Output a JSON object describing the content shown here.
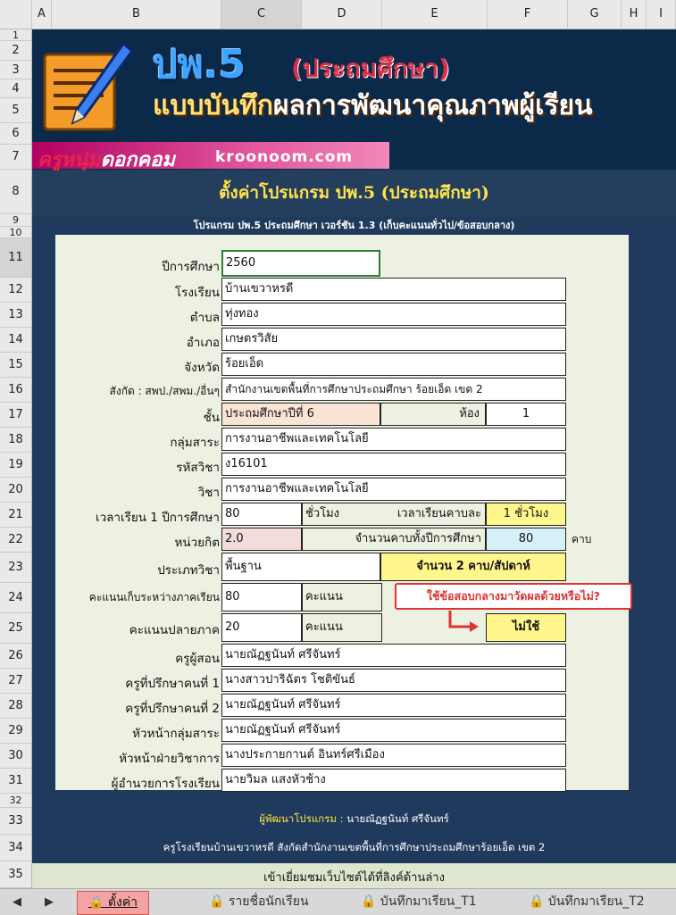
{
  "columns": [
    "A",
    "B",
    "C",
    "D",
    "E",
    "F",
    "G",
    "H",
    "I"
  ],
  "rows": [
    "1",
    "2",
    "3",
    "4",
    "5",
    "6",
    "7",
    "8",
    "9",
    "10",
    "11",
    "12",
    "13",
    "14",
    "15",
    "16",
    "17",
    "18",
    "19",
    "20",
    "21",
    "22",
    "23",
    "24",
    "25",
    "26",
    "27",
    "28",
    "29",
    "30",
    "31",
    "32",
    "33",
    "34",
    "35"
  ],
  "banner": {
    "title": "ปพ.5",
    "title_sub": "(ประถมศึกษา)",
    "line2_a": "แบบบันทึก",
    "line2_b": "ผลการพัฒนาคุณภาพผู้เรียน",
    "brand_a": "ครูหนุ่ม",
    "brand_b": "ดอกคอม",
    "site": "kroonoom.com"
  },
  "header": {
    "title": "ตั้งค่าโปรแกรม ปพ.5 (ประถมศึกษา)",
    "subtitle": "โปรแกรม ปพ.5 ประถมศึกษา เวอร์ชัน 1.3 (เก็บคะแนนทั่วไป/ข้อสอบกลาง)"
  },
  "form": {
    "year_label": "ปีการศึกษา",
    "year": "2560",
    "school_label": "โรงเรียน",
    "school": "บ้านเขวาหรดี",
    "subdistrict_label": "ตำบล",
    "subdistrict": "ทุ่งทอง",
    "district_label": "อำเภอ",
    "district": "เกษตรวิสัย",
    "province_label": "จังหวัด",
    "province": "ร้อยเอ็ด",
    "affiliation_label": "สังกัด : สพป./สพม./อื่นๆ",
    "affiliation": "สำนักงานเขตพื้นที่การศึกษาประถมศึกษา ร้อยเอ็ด เขต 2",
    "grade_label": "ชั้น",
    "grade": "ประถมศึกษาปีที่ 6",
    "room_label": "ห้อง",
    "room": "1",
    "group_label": "กลุ่มสาระ",
    "group": "การงานอาชีพและเทคโนโลยี",
    "code_label": "รหัสวิชา",
    "code": "ง16101",
    "subject_label": "วิชา",
    "subject": "การงานอาชีพและเทคโนโลยี",
    "hours_label": "เวลาเรียน 1 ปีการศึกษา",
    "hours": "80",
    "hours_unit": "ชั่วโมง",
    "period_label": "เวลาเรียนคาบละ",
    "period": "1 ชั่วโมง",
    "credit_label": "หน่วยกิต",
    "credit": "2.0",
    "periods_year_label": "จำนวนคาบทั้งปีการศึกษา",
    "periods_year": "80",
    "periods_unit": "คาบ",
    "type_label": "ประเภทวิชา",
    "type": "พื้นฐาน",
    "per_week": "จำนวน 2 คาบ/สัปดาห์",
    "mid_label": "คะแนนเก็บระหว่างภาคเรียน",
    "mid": "80",
    "mid_unit": "คะแนน",
    "final_label": "คะแนนปลายภาค",
    "final": "20",
    "final_unit": "คะแนน",
    "central_exam_question": "ใช้ข้อสอบกลางมาวัดผลด้วยหรือไม่?",
    "central_exam": "ไม่ใช้",
    "teacher_label": "ครูผู้สอน",
    "teacher": "นายณัฏฐนันท์  ศรีจันทร์",
    "advisor1_label": "ครูที่ปรึกษาคนที่ 1",
    "advisor1": "นางสาวปาริฉัตร โชติขันธ์",
    "advisor2_label": "ครูที่ปรึกษาคนที่ 2",
    "advisor2": "นายณัฏฐนันท์  ศรีจันทร์",
    "head_group_label": "หัวหน้ากลุ่มสาระ",
    "head_group": "นายณัฏฐนันท์  ศรีจันทร์",
    "head_academic_label": "หัวหน้าฝ่ายวิชาการ",
    "head_academic": "นางประกายกานต์ อินทร์ศรีเมือง",
    "director_label": "ผู้อำนวยการโรงเรียน",
    "director": "นายวิมล แสงหัวช้าง"
  },
  "footer": {
    "dev_label": "ผู้พัฒนาโปรแกรม :",
    "dev": "นายณัฏฐนันท์  ศรีจันทร์",
    "org": "ครูโรงเรียนบ้านเขวาหรดี สังกัดสำนักงานเขตพื้นที่การศึกษาประถมศึกษาร้อยเอ็ด เขต 2",
    "visit": "เข้าเยี่ยมชมเว็บไซต์ได้ที่ลิงค์ด้านล่าง"
  },
  "tabs": [
    "ตั้งค่า",
    "รายชื่อนักเรียน",
    "บันทึกมาเรียน_T1",
    "บันทึกมาเรียน_T2"
  ],
  "colors": {
    "accent_yellow": "#fff68c",
    "grade_fill": "#fbe4d6",
    "credit_fill": "#f4dcdc",
    "periods_fill": "#d7f1fb",
    "callout_red": "#d33333"
  }
}
